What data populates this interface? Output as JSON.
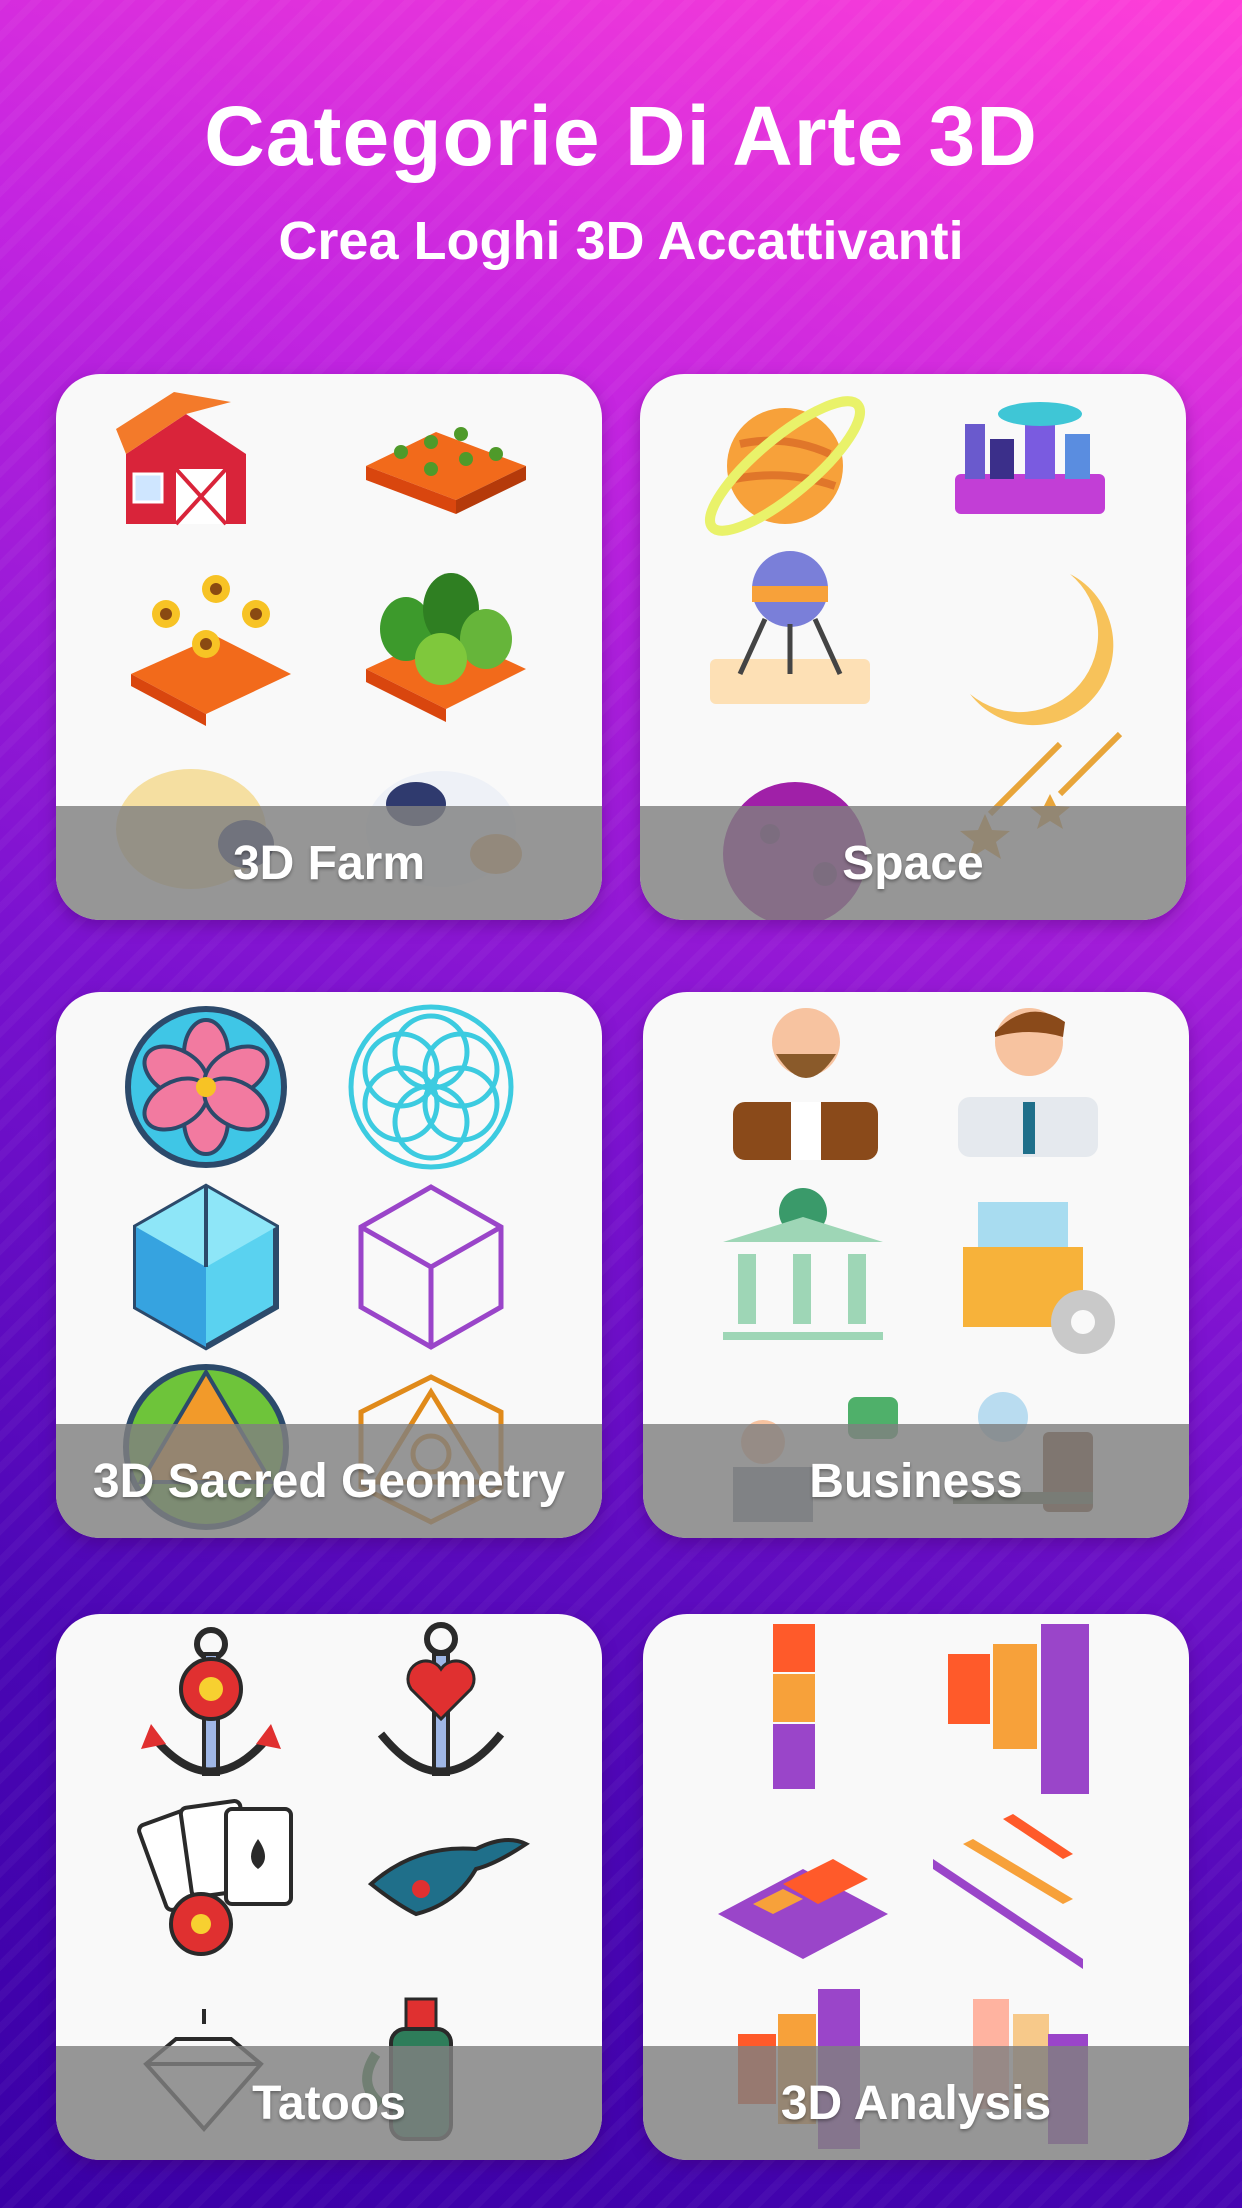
{
  "header": {
    "title": "Categorie Di Arte 3D",
    "subtitle": "Crea Loghi 3D Accattivanti"
  },
  "theme": {
    "background_top": "#ff3fd8",
    "background_bottom": "#3a00a6",
    "card_background": "#f9f9f9",
    "label_bar": "#808080"
  },
  "categories": [
    {
      "label": "3D Farm",
      "icons": [
        "barn-icon",
        "crop-field-icon",
        "sunflower-field-icon",
        "vegetable-field-icon",
        "sheep-icon",
        "cow-icon"
      ]
    },
    {
      "label": "Space",
      "icons": [
        "planet-icon",
        "space-city-icon",
        "space-probe-icon",
        "moon-icon",
        "purple-planet-icon",
        "meteor-shower-icon"
      ]
    },
    {
      "label": "3D Sacred Geometry",
      "icons": [
        "flower-of-life-pink-icon",
        "seed-of-life-icon",
        "blue-hexagon-cube-icon",
        "wireframe-cube-icon",
        "green-star-tetrahedron-icon",
        "orange-triangle-hexagon-icon"
      ]
    },
    {
      "label": "Business",
      "icons": [
        "bearded-businessman-icon",
        "businessman-icon",
        "bank-icon",
        "product-box-gear-icon",
        "consultant-icon",
        "coffee-break-icon"
      ]
    },
    {
      "label": "Tatoos",
      "icons": [
        "anchor-flower-icon",
        "anchor-heart-icon",
        "playing-cards-icon",
        "swallow-bird-icon",
        "diamond-icon",
        "bottle-icon"
      ]
    },
    {
      "label": "3D Analysis",
      "icons": [
        "stacked-blocks-icon",
        "3d-bar-chart-icon",
        "isometric-grid-icon",
        "isometric-ramp-icon",
        "cylinder-chart-icon",
        "pastel-cylinder-chart-icon"
      ]
    }
  ]
}
